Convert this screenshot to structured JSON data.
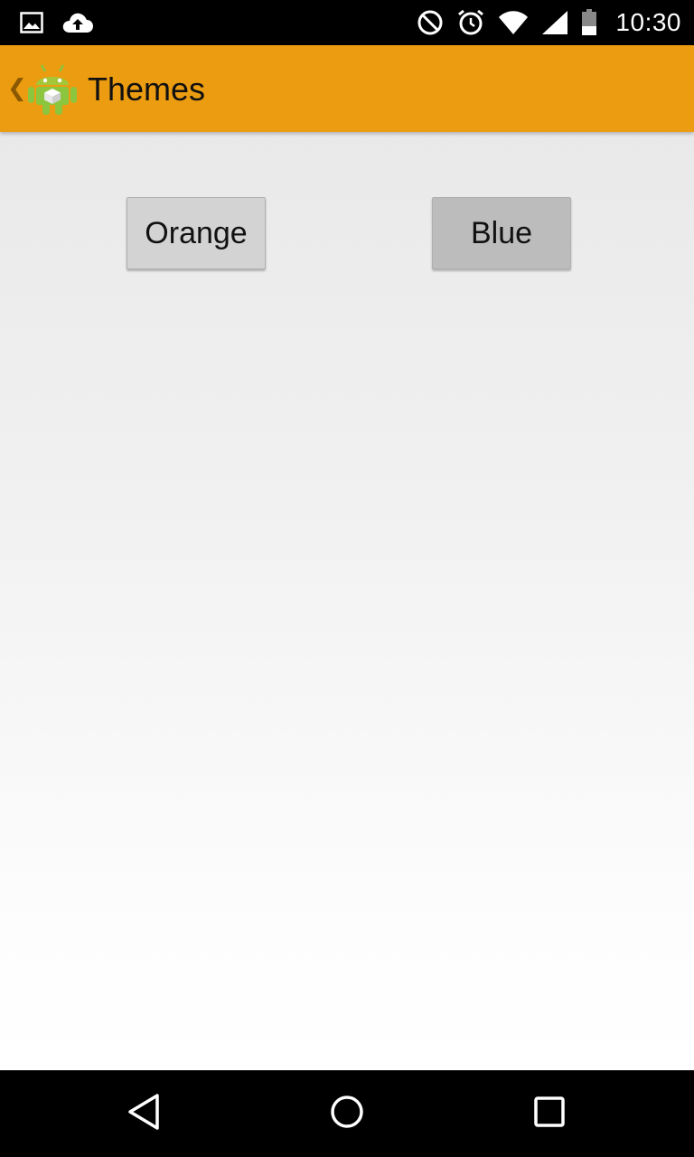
{
  "status_bar": {
    "time": "10:30",
    "left_icons": [
      "image-icon",
      "cloud-upload-icon"
    ],
    "right_icons": [
      "do-not-disturb-icon",
      "alarm-icon",
      "wifi-icon",
      "cellular-signal-icon",
      "battery-icon"
    ]
  },
  "action_bar": {
    "title": "Themes",
    "background_color": "#eb9c10",
    "up_icon": "chevron-left-icon",
    "logo_icon": "android-robot-icon"
  },
  "main": {
    "buttons": [
      {
        "label": "Orange"
      },
      {
        "label": "Blue"
      }
    ]
  },
  "nav_bar": {
    "icons": [
      "back-icon",
      "home-icon",
      "recent-apps-icon"
    ]
  }
}
